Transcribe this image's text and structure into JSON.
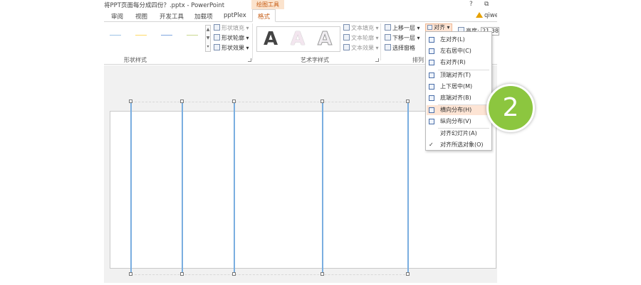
{
  "window": {
    "title": "将PPT页面每分成四份？.pptx - PowerPoint",
    "context_tab": "绘图工具",
    "help": "?",
    "restore": "⧉"
  },
  "tabs": [
    "审阅",
    "视图",
    "开发工具",
    "加载项",
    "pptPlex",
    "格式"
  ],
  "active_tab": "格式",
  "user": "qiwe",
  "ribbon": {
    "shape_fill": "形状填充",
    "shape_outline": "形状轮廓",
    "shape_effects": "形状效果",
    "shape_styles_label": "形状样式",
    "style_line_colors": [
      "#9dc3e6",
      "#ffd966",
      "#7fa7e0",
      "#c9d88f"
    ],
    "art_styles_label": "艺术字样式",
    "text_fill": "文本填充",
    "text_outline": "文本轮廓",
    "text_effects": "文本效果",
    "bring_forward": "上移一层",
    "send_backward": "下移一层",
    "selection_pane": "选择窗格",
    "align_button": "对齐",
    "arrange_label": "排列",
    "height_label": "高度:",
    "height_value": "21.38",
    "art_letters": [
      "A",
      "A",
      "A"
    ]
  },
  "align_menu": {
    "items": [
      {
        "label": "左对齐(L)",
        "icon": "align-left-icon"
      },
      {
        "label": "左右居中(C)",
        "icon": "align-center-icon"
      },
      {
        "label": "右对齐(R)",
        "icon": "align-right-icon"
      },
      {
        "label": "顶端对齐(T)",
        "icon": "align-top-icon"
      },
      {
        "label": "上下居中(M)",
        "icon": "align-middle-icon"
      },
      {
        "label": "底端对齐(B)",
        "icon": "align-bottom-icon"
      },
      {
        "label": "横向分布(H)",
        "icon": "distribute-horizontal-icon"
      },
      {
        "label": "纵向分布(V)",
        "icon": "distribute-vertical-icon"
      },
      {
        "label": "对齐幻灯片(A)",
        "icon": ""
      },
      {
        "label": "对齐所选对象(O)",
        "icon": "checkmark-icon"
      }
    ],
    "highlighted": "横向分布(H)"
  },
  "callout": {
    "number": "2",
    "color": "#8cc63f"
  }
}
